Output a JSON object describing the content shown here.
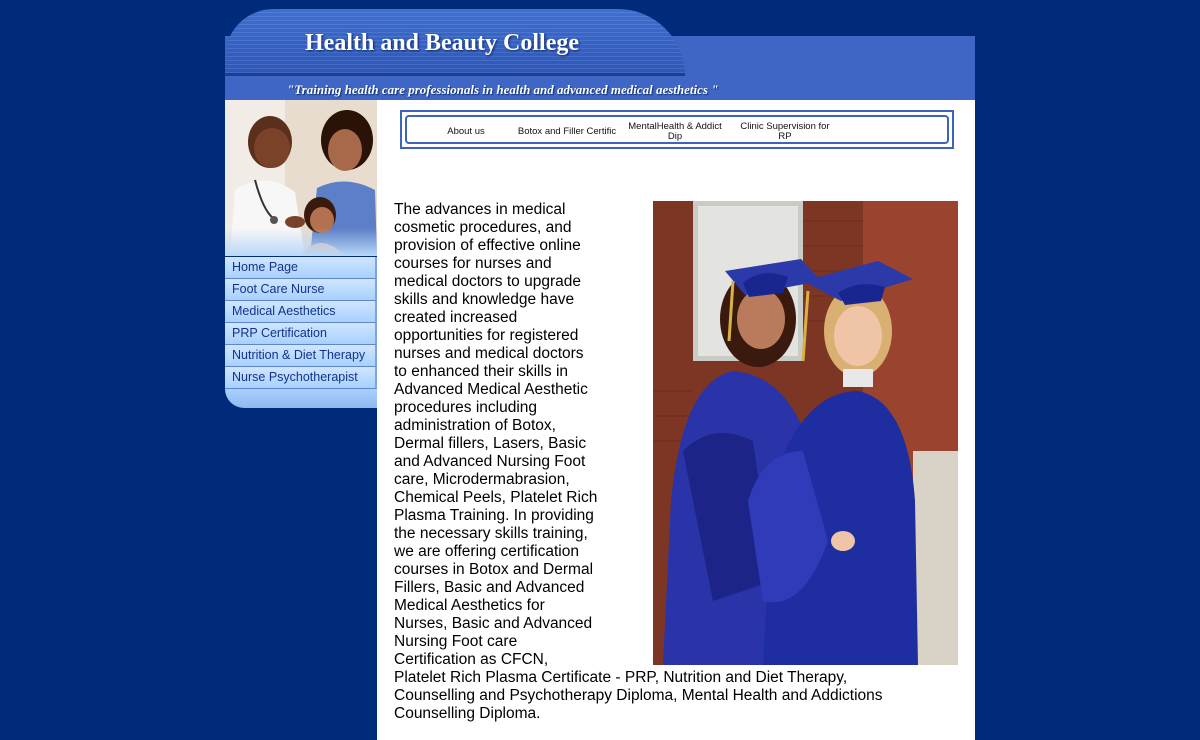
{
  "header": {
    "title": "Health and Beauty College",
    "tagline": "\"Training health care professionals in health and advanced medical aesthetics \""
  },
  "sidebar": {
    "items": [
      {
        "label": "Home Page"
      },
      {
        "label": "Foot Care Nurse"
      },
      {
        "label": "Medical Aesthetics"
      },
      {
        "label": "PRP Certification"
      },
      {
        "label": "Nutrition & Diet Therapy"
      },
      {
        "label": "Nurse Psychotherapist"
      }
    ]
  },
  "topnav": {
    "items": [
      {
        "label": "About us"
      },
      {
        "label": "Botox and Filler Certific"
      },
      {
        "label": "MentalHealth & Addict Dip"
      },
      {
        "label": "Clinic Supervision for RP"
      }
    ]
  },
  "main": {
    "intro": "The advances in medical cosmetic procedures, and provision of effective online courses for nurses and medical doctors to upgrade skills and knowledge have created increased opportunities for registered nurses and medical doctors  to enhanced their skills in Advanced Medical Aesthetic procedures including administration of Botox, Dermal fillers, Lasers, Basic and Advanced Nursing Foot care, Microdermabrasion, Chemical Peels, Platelet Rich Plasma Training.  In providing the necessary skills training, we are offering certification courses in Botox and Dermal Fillers, Basic and Advanced Medical Aesthetics for Nurses, Basic and Advanced Nursing Foot care Certification as CFCN, Platelet Rich Plasma Certificate - PRP, Nutrition and Diet Therapy, Counselling and Psychotherapy Diploma,  Mental Health and Addictions Counselling Diploma."
  },
  "colors": {
    "background": "#002a7a",
    "header_band": "#3f66c4",
    "nav_text": "#12338a",
    "nav_bg": "#b9dcff"
  }
}
